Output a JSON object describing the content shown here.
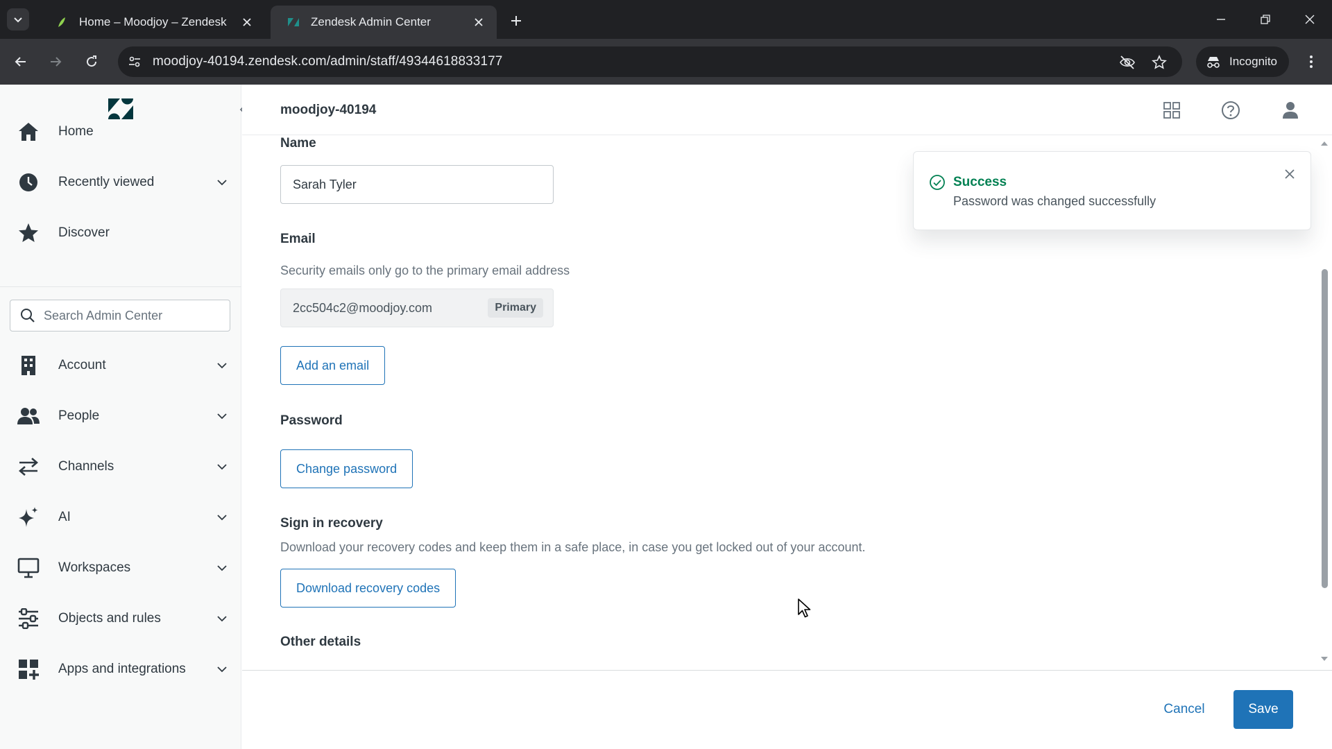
{
  "browser": {
    "tabs": [
      {
        "title": "Home – Moodjoy – Zendesk",
        "active": false
      },
      {
        "title": "Zendesk Admin Center",
        "active": true
      }
    ],
    "url": "moodjoy-40194.zendesk.com/admin/staff/49344618833177",
    "incognito_label": "Incognito"
  },
  "header": {
    "subdomain": "moodjoy-40194"
  },
  "sidebar": {
    "top_items": [
      {
        "label": "Home",
        "icon": "home-icon"
      },
      {
        "label": "Recently viewed",
        "icon": "clock-icon"
      },
      {
        "label": "Discover",
        "icon": "star-icon"
      }
    ],
    "search_placeholder": "Search Admin Center",
    "items": [
      {
        "label": "Account",
        "icon": "building-icon"
      },
      {
        "label": "People",
        "icon": "people-icon"
      },
      {
        "label": "Channels",
        "icon": "channels-icon"
      },
      {
        "label": "AI",
        "icon": "sparkle-icon"
      },
      {
        "label": "Workspaces",
        "icon": "monitor-icon"
      },
      {
        "label": "Objects and rules",
        "icon": "objects-rules-icon"
      },
      {
        "label": "Apps and integrations",
        "icon": "apps-icon"
      }
    ]
  },
  "form": {
    "name_label": "Name",
    "name_value": "Sarah Tyler",
    "email_label": "Email",
    "email_hint": "Security emails only go to the primary email address",
    "email_value": "2cc504c2@moodjoy.com",
    "email_badge": "Primary",
    "add_email_label": "Add an email",
    "password_label": "Password",
    "change_password_label": "Change password",
    "recovery_label": "Sign in recovery",
    "recovery_hint": "Download your recovery codes and keep them in a safe place, in case you get locked out of your account.",
    "download_codes_label": "Download recovery codes",
    "other_details_label": "Other details"
  },
  "footer": {
    "cancel_label": "Cancel",
    "save_label": "Save"
  },
  "toast": {
    "title": "Success",
    "message": "Password was changed successfully"
  },
  "colors": {
    "accent": "#1f73b7",
    "success": "#038153"
  }
}
